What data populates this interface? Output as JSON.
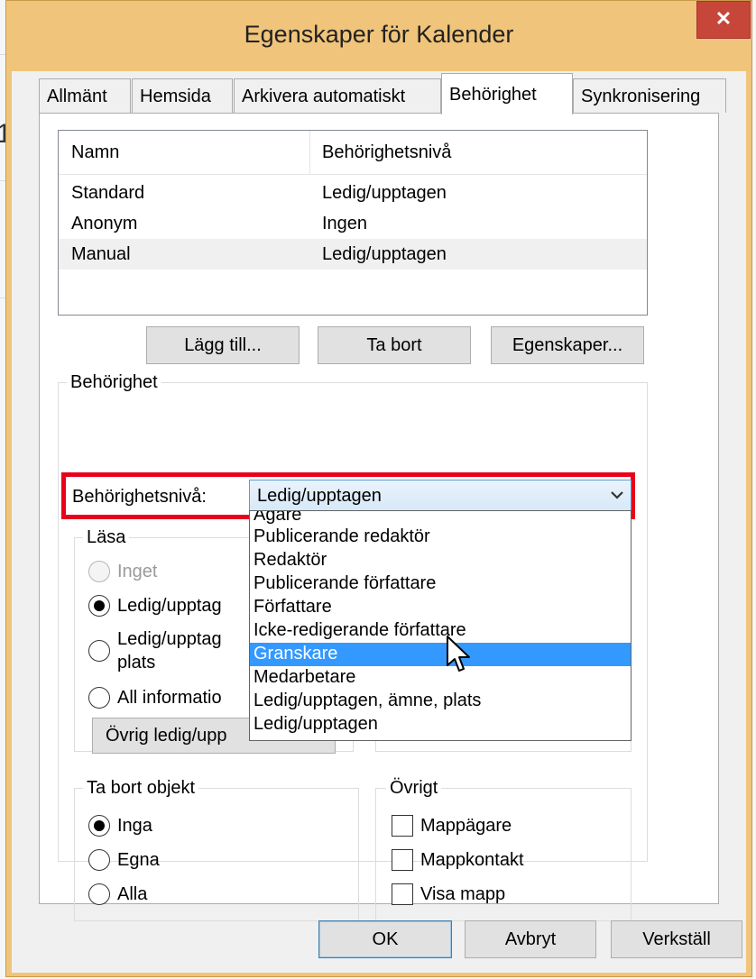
{
  "window": {
    "title": "Egenskaper för Kalender",
    "close_glyph": "✕"
  },
  "background": {
    "digit": "1"
  },
  "tabs": [
    {
      "label": "Allmänt"
    },
    {
      "label": "Hemsida"
    },
    {
      "label": "Arkivera automatiskt"
    },
    {
      "label": "Behörighet"
    },
    {
      "label": "Synkronisering"
    }
  ],
  "permissions_list": {
    "columns": [
      "Namn",
      "Behörighetsnivå"
    ],
    "rows": [
      {
        "name": "Standard",
        "level": "Ledig/upptagen"
      },
      {
        "name": "Anonym",
        "level": "Ingen"
      },
      {
        "name": "Manual",
        "level": "Ledig/upptagen"
      }
    ]
  },
  "list_buttons": {
    "add": "Lägg till...",
    "remove": "Ta bort",
    "properties": "Egenskaper..."
  },
  "permission_group": {
    "label": "Behörighet",
    "level_label": "Behörighetsnivå:",
    "level_value": "Ledig/upptagen"
  },
  "dropdown_options": [
    "Ägare",
    "Publicerande redaktör",
    "Redaktör",
    "Publicerande författare",
    "Författare",
    "Icke-redigerande författare",
    "Granskare",
    "Medarbetare",
    "Ledig/upptagen, ämne, plats",
    "Ledig/upptagen"
  ],
  "dropdown_highlighted": "Granskare",
  "read_group": {
    "label": "Läsa",
    "options": {
      "none": "Inget",
      "free_busy": "Ledig/upptag",
      "free_busy_subject_1": "Ledig/upptag",
      "free_busy_subject_2": "plats",
      "all": "All informatio"
    },
    "other_button": "Övrig ledig/upp"
  },
  "delete_group": {
    "label": "Ta bort objekt",
    "options": {
      "none": "Inga",
      "own": "Egna",
      "all": "Alla"
    }
  },
  "other_group": {
    "label": "Övrigt",
    "options": {
      "owner": "Mappägare",
      "contact": "Mappkontakt",
      "visible": "Visa mapp"
    }
  },
  "dialog_buttons": {
    "ok": "OK",
    "cancel": "Avbryt",
    "apply": "Verkställ"
  },
  "colors": {
    "highlight": "#3399ff",
    "red_outline": "#e8001c",
    "title_bar": "#f0c47a",
    "close": "#c7463a"
  }
}
